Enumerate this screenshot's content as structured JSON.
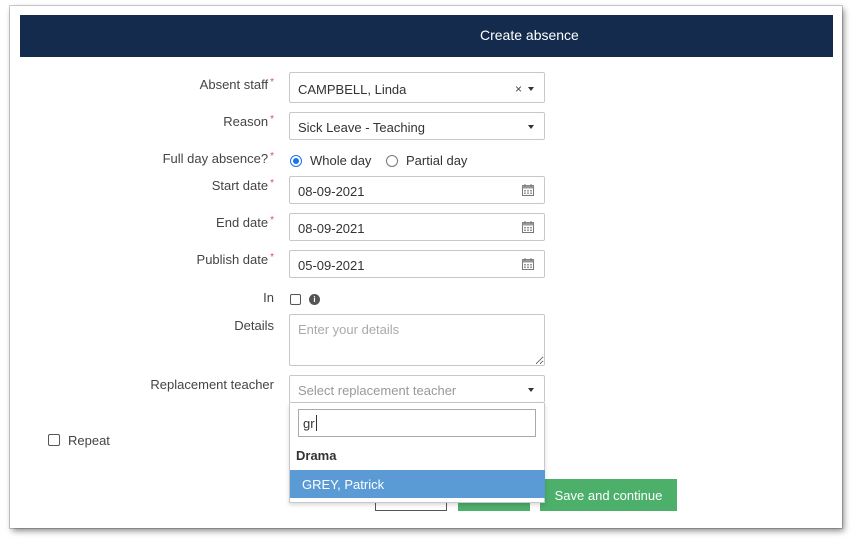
{
  "dialog": {
    "title": "Create absence"
  },
  "form": {
    "absent_staff": {
      "label": "Absent staff",
      "value": "CAMPBELL, Linda",
      "clear": "×"
    },
    "reason": {
      "label": "Reason",
      "value": "Sick Leave - Teaching"
    },
    "full_day": {
      "label": "Full day absence?",
      "options": [
        "Whole day",
        "Partial day"
      ],
      "selected": "Whole day"
    },
    "start_date": {
      "label": "Start date",
      "value": "08-09-2021"
    },
    "end_date": {
      "label": "End date",
      "value": "08-09-2021"
    },
    "publish_date": {
      "label": "Publish date",
      "value": "05-09-2021"
    },
    "in": {
      "label": "In",
      "info": "i"
    },
    "details": {
      "label": "Details",
      "placeholder": "Enter your details"
    },
    "replacement": {
      "label": "Replacement teacher",
      "placeholder": "Select replacement teacher",
      "search_value": "gr",
      "group": "Drama",
      "highlighted_option": "GREY, Patrick"
    },
    "repeat": {
      "label": "Repeat"
    },
    "required_mark": "*"
  },
  "buttons": {
    "save_continue": "Save and continue"
  },
  "colors": {
    "header": "#142b4e",
    "accent_blue": "#1a73e8",
    "highlight": "#5b9bd5",
    "save_green": "#4caf6a",
    "required": "#d9534f"
  }
}
